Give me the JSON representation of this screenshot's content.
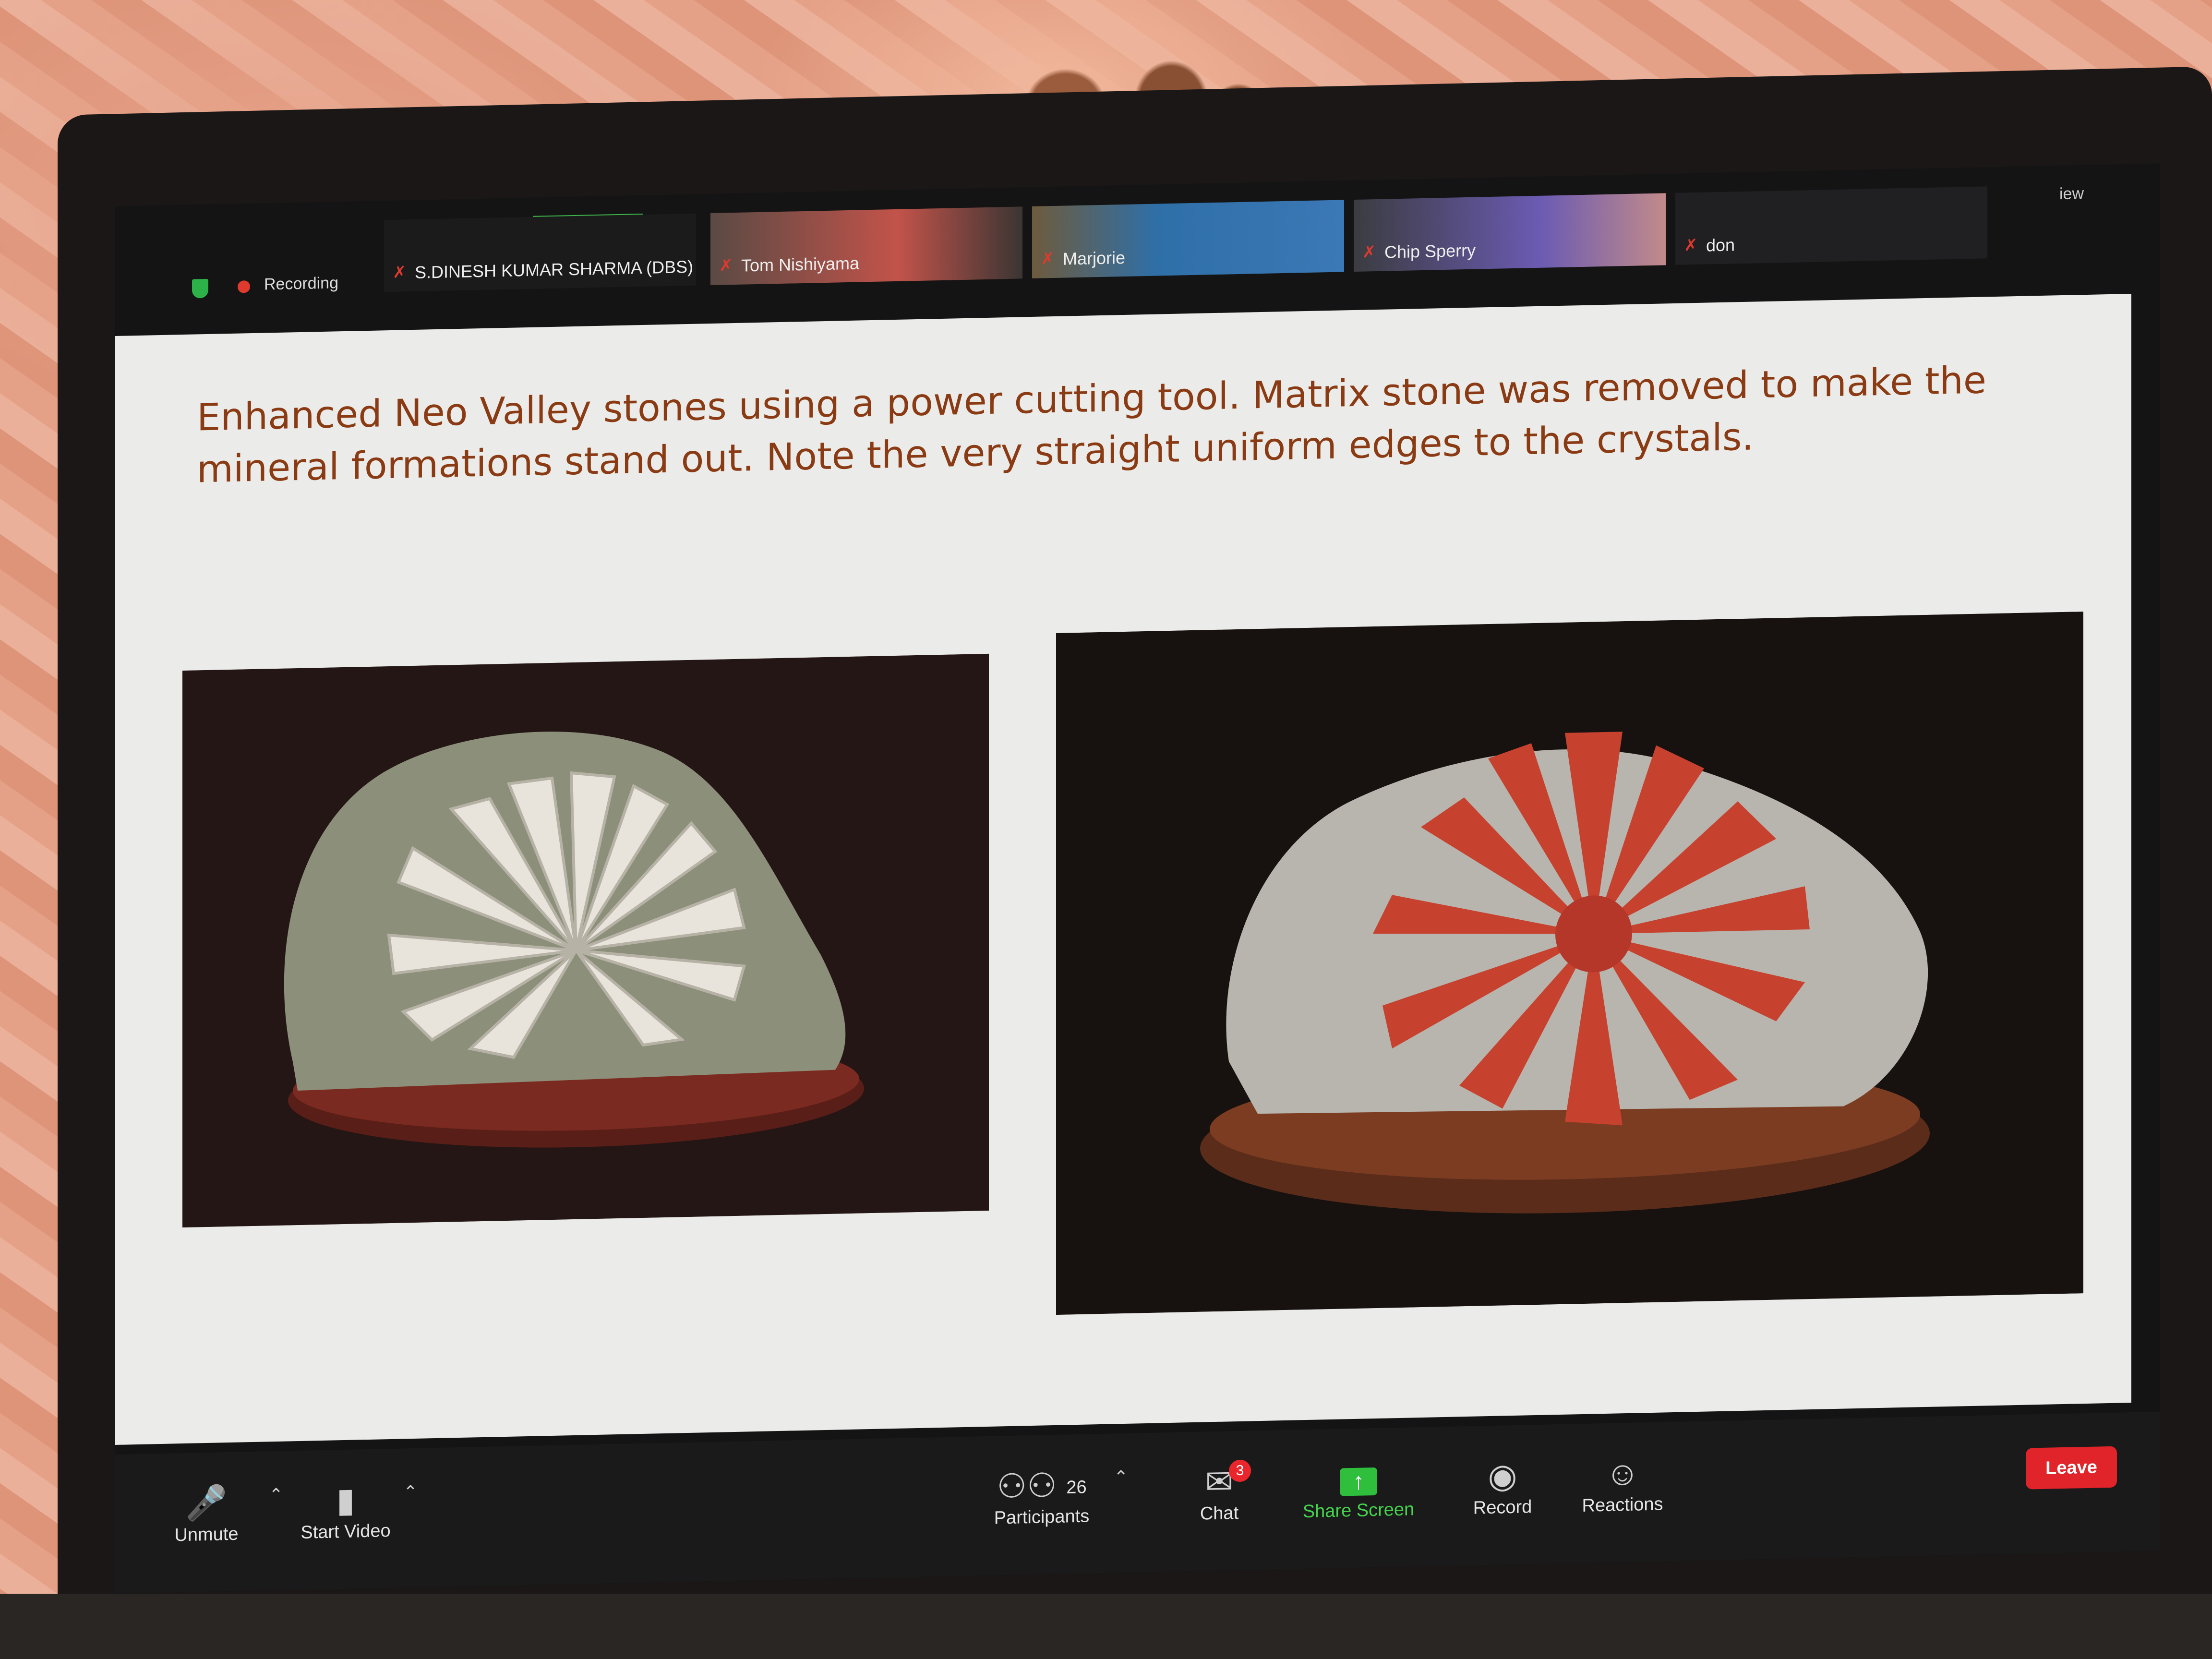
{
  "top_bar": {
    "recording_label": "Recording",
    "participants": [
      {
        "name": "S.DINESH KUMAR SHARMA (DBS)",
        "muted": true
      },
      {
        "name": "Tom Nishiyama",
        "muted": true
      },
      {
        "name": "Marjorie",
        "muted": true
      },
      {
        "name": "Chip Sperry",
        "muted": true
      },
      {
        "name": "don",
        "muted": true
      }
    ],
    "view_label": "iew"
  },
  "slide": {
    "title": "Enhanced Neo Valley stones using a power cutting tool. Matrix stone was removed to make the mineral formations stand out. Note the very straight uniform edges to the crystals."
  },
  "toolbar": {
    "unmute_label": "Unmute",
    "start_video_label": "Start Video",
    "participants_label": "Participants",
    "participants_count": "26",
    "chat_label": "Chat",
    "chat_badge": "3",
    "share_screen_label": "Share Screen",
    "record_label": "Record",
    "reactions_label": "Reactions",
    "leave_label": "Leave"
  },
  "colors": {
    "slide_title": "#8a3b14",
    "share_green": "#45d24c",
    "leave_red": "#e0242a",
    "recording_red": "#e03a2f"
  }
}
